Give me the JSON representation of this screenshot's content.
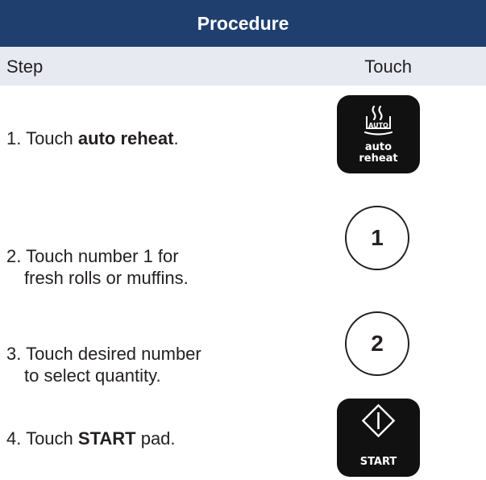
{
  "header": {
    "title": "Procedure"
  },
  "columns": {
    "step": "Step",
    "touch": "Touch"
  },
  "steps": [
    {
      "pre": "1. Touch ",
      "bold": "auto reheat",
      "post": "."
    },
    {
      "line1": "2. Touch number 1 for",
      "line2": "fresh rolls or muffins."
    },
    {
      "line1": "3. Touch desired number",
      "line2": "to select quantity."
    },
    {
      "pre": "4. Touch ",
      "bold": "START",
      "post": " pad."
    }
  ],
  "pads": {
    "auto_reheat": {
      "badge": "AUTO",
      "label_line1": "auto",
      "label_line2": "reheat",
      "icon": "auto-reheat-icon"
    },
    "number1": "1",
    "number2": "2",
    "start": {
      "label": "START",
      "icon": "start-diamond-icon"
    }
  },
  "colors": {
    "header_bg": "#1f3f6e",
    "subheader_bg": "#e8eaf1",
    "pad_bg": "#111111",
    "text": "#231f20"
  }
}
